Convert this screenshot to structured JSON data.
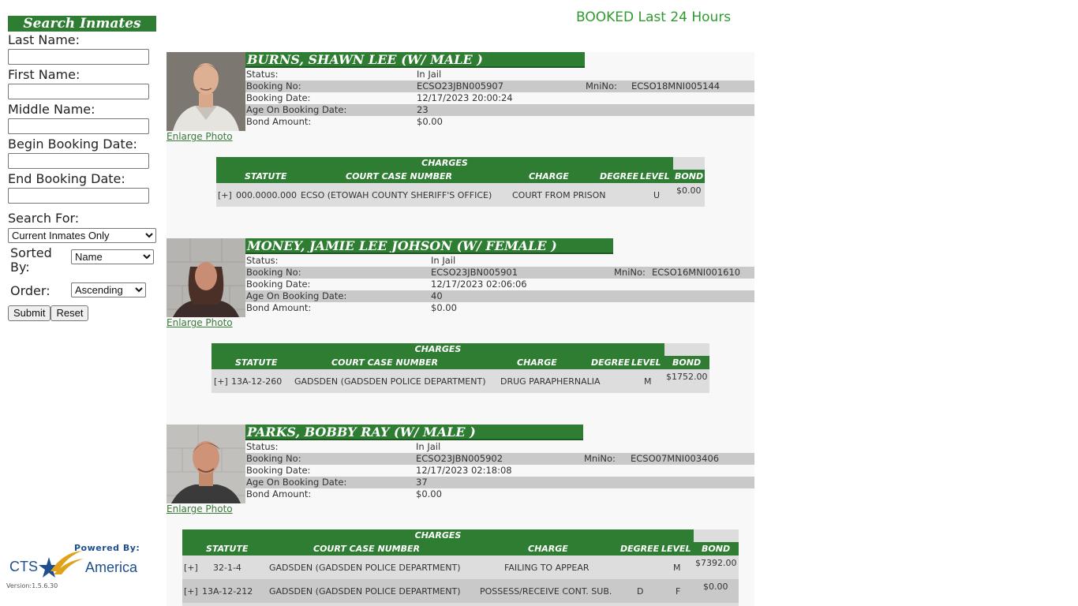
{
  "sidebar": {
    "title": "Search Inmates",
    "last_name_label": "Last Name:",
    "first_name_label": "First Name:",
    "middle_name_label": "Middle Name:",
    "begin_date_label": "Begin Booking Date:",
    "end_date_label": "End Booking Date:",
    "search_for_label": "Search For:",
    "search_for_value": "Current Inmates Only",
    "sorted_by_label": "Sorted By:",
    "sorted_by_value": "Name",
    "order_label": "Order:",
    "order_value": "Ascending",
    "submit_label": "Submit",
    "reset_label": "Reset"
  },
  "page_title": "BOOKED Last 24 Hours",
  "labels": {
    "status": "Status:",
    "booking_no": "Booking No:",
    "booking_date": "Booking Date:",
    "age": "Age On Booking Date:",
    "bond_amount": "Bond Amount:",
    "mnino": "MniNo:",
    "enlarge": "Enlarge Photo",
    "charges": "CHARGES",
    "statute": "STATUTE",
    "court_case": "COURT CASE NUMBER",
    "charge": "CHARGE",
    "degree": "DEGREE",
    "level": "LEVEL",
    "bond": "BOND"
  },
  "inmates": [
    {
      "name": "BURNS, SHAWN LEE   (W/ MALE )",
      "status": "In Jail",
      "booking_no": "ECSO23JBN005907",
      "mnino": "ECSO18MNI005144",
      "booking_date": "12/17/2023 20:00:24",
      "age": "23",
      "bond_amount": "$0.00",
      "charges": [
        {
          "expand": "[+]",
          "statute": "000.0000.000",
          "court": "ECSO (ETOWAH COUNTY SHERIFF'S OFFICE)",
          "charge": "COURT FROM PRISON",
          "degree": "",
          "level": "U",
          "bond": "$0.00"
        }
      ]
    },
    {
      "name": "MONEY, JAMIE LEE JOHSON   (W/ FEMALE )",
      "status": "In Jail",
      "booking_no": "ECSO23JBN005901",
      "mnino": "ECSO16MNI001610",
      "booking_date": "12/17/2023 02:06:06",
      "age": "40",
      "bond_amount": "$0.00",
      "charges": [
        {
          "expand": "[+]",
          "statute": "13A-12-260",
          "court": "GADSDEN (GADSDEN POLICE DEPARTMENT)",
          "charge": "DRUG PARAPHERNALIA",
          "degree": "",
          "level": "M",
          "bond": "$1752.00"
        }
      ]
    },
    {
      "name": "PARKS, BOBBY RAY   (W/ MALE )",
      "status": "In Jail",
      "booking_no": "ECSO23JBN005902",
      "mnino": "ECSO07MNI003406",
      "booking_date": "12/17/2023 02:18:08",
      "age": "37",
      "bond_amount": "$0.00",
      "charges": [
        {
          "expand": "[+]",
          "statute": "32-1-4",
          "court": "GADSDEN (GADSDEN POLICE DEPARTMENT)",
          "charge": "FAILING TO APPEAR",
          "degree": "",
          "level": "M",
          "bond": "$7392.00"
        },
        {
          "expand": "[+]",
          "statute": "13A-12-212",
          "court": "GADSDEN (GADSDEN POLICE DEPARTMENT)",
          "charge": "POSSESS/RECEIVE CONT. SUB.",
          "degree": "D",
          "level": "F",
          "bond": "$0.00"
        }
      ]
    }
  ],
  "footer": {
    "powered_by": "Powered By:",
    "brand_cts": "CTS",
    "brand_america": "America",
    "version": "Version:1.5.6.30"
  }
}
